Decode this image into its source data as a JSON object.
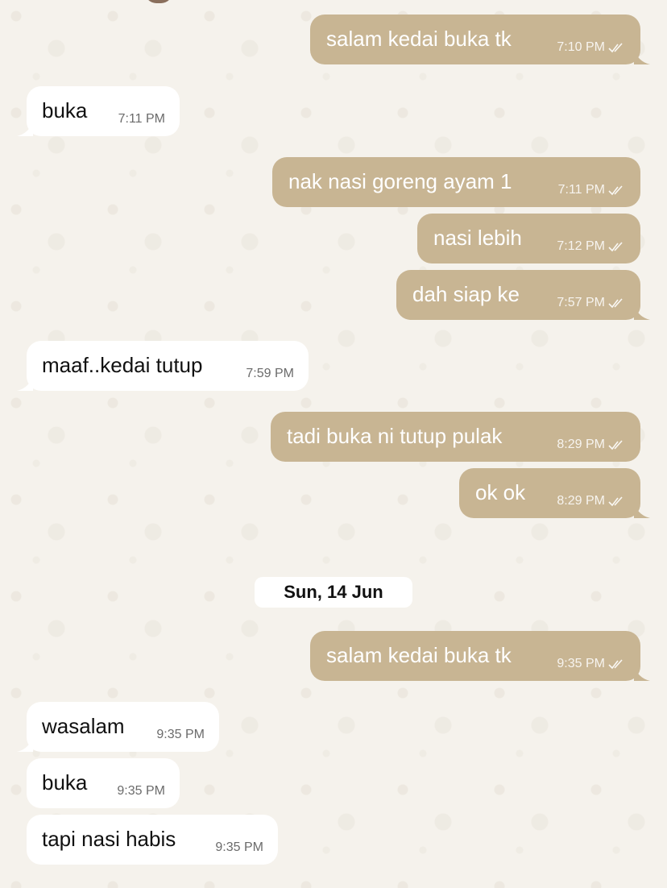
{
  "conversation": {
    "messages": [
      {
        "direction": "out",
        "text": "salam kedai buka tk",
        "time": "7:10 PM",
        "status": "read-ticks"
      },
      {
        "direction": "in",
        "text": "buka",
        "time": "7:11 PM"
      },
      {
        "direction": "out",
        "text": "nak nasi goreng ayam 1",
        "time": "7:11 PM",
        "status": "read-ticks"
      },
      {
        "direction": "out",
        "text": "nasi lebih",
        "time": "7:12 PM",
        "status": "read-ticks"
      },
      {
        "direction": "out",
        "text": "dah siap ke",
        "time": "7:57 PM",
        "status": "read-ticks"
      },
      {
        "direction": "in",
        "text": "maaf..kedai tutup",
        "time": "7:59 PM"
      },
      {
        "direction": "out",
        "text": "tadi buka ni tutup pulak",
        "time": "8:29 PM",
        "status": "read-ticks"
      },
      {
        "direction": "out",
        "text": "ok ok",
        "time": "8:29 PM",
        "status": "read-ticks"
      },
      {
        "direction": "out",
        "text": "salam kedai buka tk",
        "time": "9:35 PM",
        "status": "read-ticks"
      },
      {
        "direction": "in",
        "text": "wasalam",
        "time": "9:35 PM"
      },
      {
        "direction": "in",
        "text": "buka",
        "time": "9:35 PM"
      },
      {
        "direction": "in",
        "text": "tapi nasi habis",
        "time": "9:35 PM"
      }
    ],
    "date_separator": "Sun, 14 Jun"
  },
  "colors": {
    "outgoing_bubble": "#c8b593",
    "incoming_bubble": "#ffffff",
    "chat_background": "#f5f2ec"
  }
}
